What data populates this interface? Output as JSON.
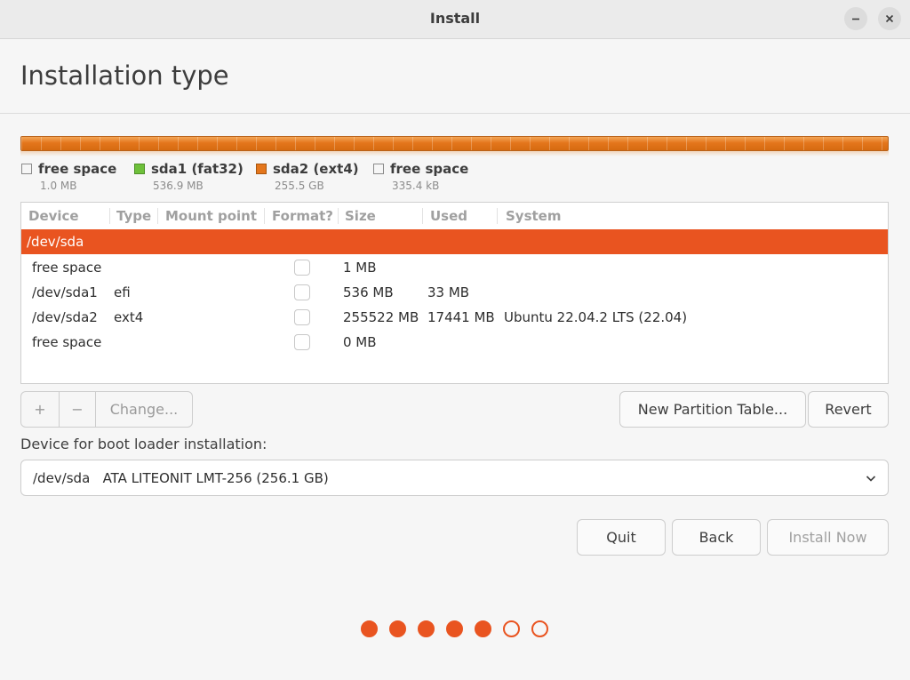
{
  "window": {
    "title": "Install"
  },
  "page": {
    "heading": "Installation type"
  },
  "legend": [
    {
      "name": "free space",
      "size": "1.0 MB",
      "color": "#f6f6f6"
    },
    {
      "name": "sda1 (fat32)",
      "size": "536.9 MB",
      "color": "#6ec03a"
    },
    {
      "name": "sda2 (ext4)",
      "size": "255.5 GB",
      "color": "#e4761c"
    },
    {
      "name": "free space",
      "size": "335.4 kB",
      "color": "#f6f6f6"
    }
  ],
  "table": {
    "columns": [
      "Device",
      "Type",
      "Mount point",
      "Format?",
      "Size",
      "Used",
      "System"
    ],
    "rows": [
      {
        "device": "/dev/sda",
        "type": "",
        "mount": "",
        "size": "",
        "used": "",
        "system": ""
      },
      {
        "device": "free space",
        "type": "",
        "mount": "",
        "format": false,
        "size": "1 MB",
        "used": "",
        "system": ""
      },
      {
        "device": "/dev/sda1",
        "type": "efi",
        "mount": "",
        "format": false,
        "size": "536 MB",
        "used": "33 MB",
        "system": ""
      },
      {
        "device": "/dev/sda2",
        "type": "ext4",
        "mount": "",
        "format": false,
        "size": "255522 MB",
        "used": "17441 MB",
        "system": "Ubuntu 22.04.2 LTS (22.04)"
      },
      {
        "device": "free space",
        "type": "",
        "mount": "",
        "format": false,
        "size": "0 MB",
        "used": "",
        "system": ""
      }
    ]
  },
  "partition_buttons": {
    "add": "+",
    "remove": "−",
    "change": "Change..."
  },
  "buttons": {
    "new_table": "New Partition Table...",
    "revert": "Revert",
    "quit": "Quit",
    "back": "Back",
    "install": "Install Now"
  },
  "bootloader": {
    "label": "Device for boot loader installation:",
    "value": "/dev/sda   ATA LITEONIT LMT-256 (256.1 GB)"
  },
  "progress": {
    "current_step": 5,
    "total_steps": 7
  },
  "colors": {
    "accent": "#e95420",
    "selection": "#e95420"
  }
}
